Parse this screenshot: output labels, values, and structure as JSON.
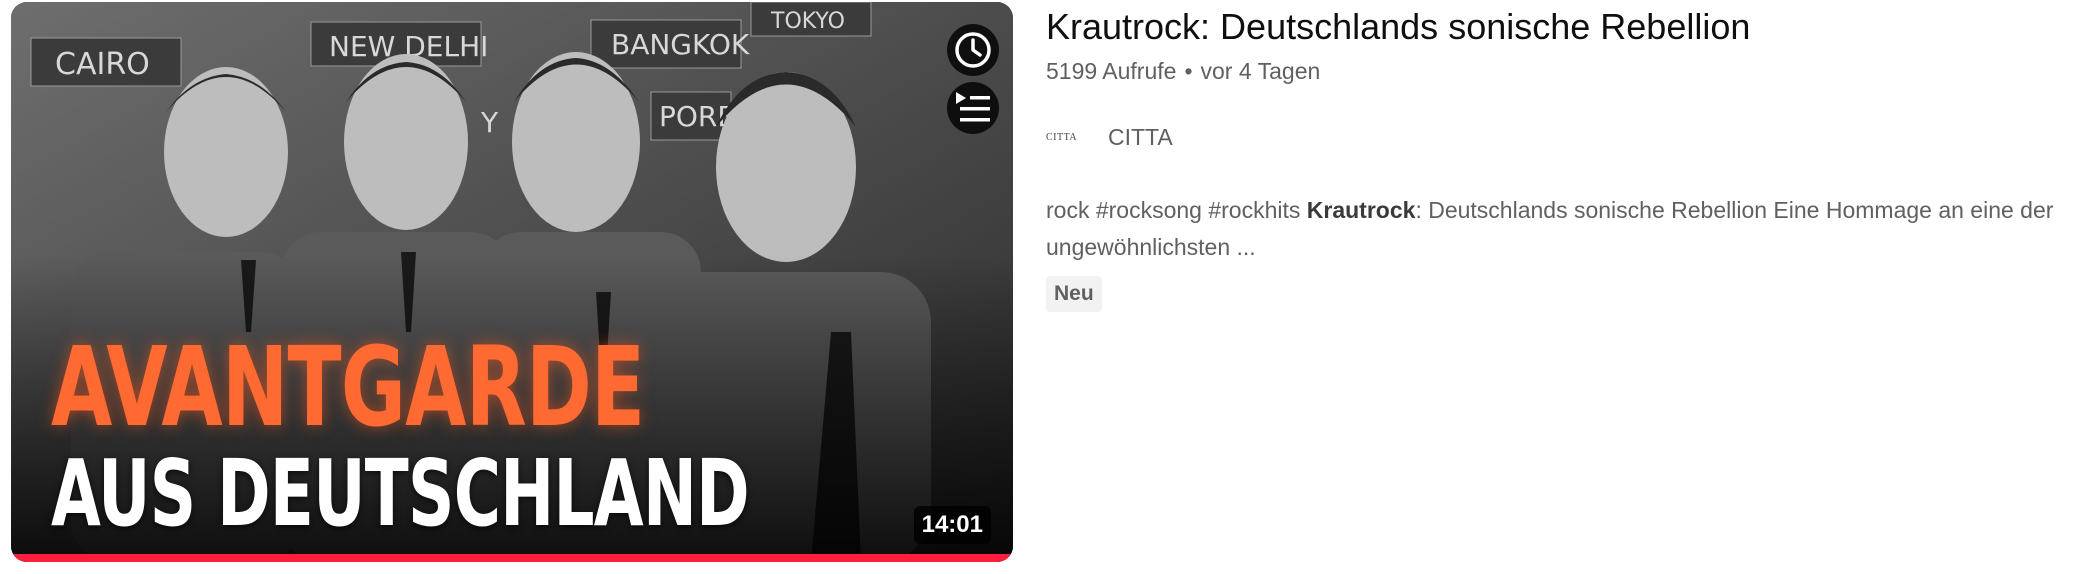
{
  "video": {
    "thumbnail": {
      "headline_line1": "AVANTGARDE",
      "headline_line2": "AUS DEUTSCHLAND",
      "sign_labels": [
        "CAIRO",
        "NEW DELHI",
        "BANGKOK",
        "TOKYO",
        "PORE",
        "Y"
      ],
      "duration": "14:01",
      "watch_progress": 1.0,
      "progress_color": "#ff1f3d",
      "headline_color": "#ff6a33",
      "icons": [
        "clock-icon",
        "add-to-queue-icon"
      ]
    },
    "title": "Krautrock: Deutschlands sonische Rebellion",
    "views": "5199 Aufrufe",
    "separator": "•",
    "published": "vor 4 Tagen",
    "channel": {
      "avatar_text": "CITTA",
      "name": "CITTA"
    },
    "description": {
      "prefix": "rock #rocksong #rockhits ",
      "highlight": "Krautrock",
      "rest": ": Deutschlands sonische Rebellion Eine Hommage an eine der ungewöhnlichsten ..."
    },
    "badge": "Neu"
  }
}
